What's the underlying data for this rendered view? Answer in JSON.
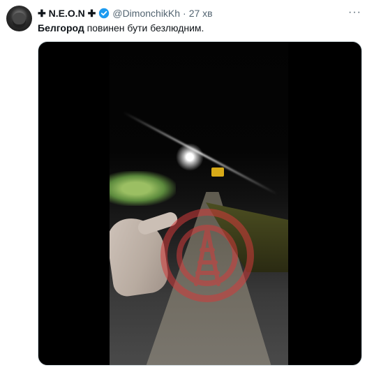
{
  "tweet": {
    "author_name": "✚ N.E.O.N ✚",
    "handle": "@DimonchikKh",
    "separator": "·",
    "time": "27 хв",
    "more": "···",
    "text_bold": "Белгород",
    "text_rest": " повинен бути безлюдним."
  },
  "colors": {
    "verified_blue": "#1d9bf0",
    "muted_text": "#536471",
    "watermark_red": "#d23b3b"
  },
  "icons": {
    "verified": "verified-badge-icon",
    "watermark": "radio-tower-watermark-icon"
  }
}
